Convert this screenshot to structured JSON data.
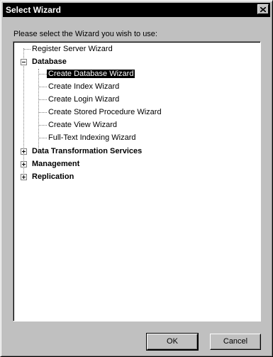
{
  "window": {
    "title": "Select Wizard",
    "close_label": "×"
  },
  "prompt": "Please select the Wizard you wish to use:",
  "tree": {
    "register": "Register Server Wizard",
    "database": "Database",
    "database_children": [
      "Create Database Wizard",
      "Create Index Wizard",
      "Create Login Wizard",
      "Create Stored Procedure Wizard",
      "Create View Wizard",
      "Full-Text Indexing Wizard"
    ],
    "dts": "Data Transformation Services",
    "management": "Management",
    "replication": "Replication",
    "selected": "Create Database Wizard"
  },
  "buttons": {
    "ok": "OK",
    "cancel": "Cancel"
  }
}
